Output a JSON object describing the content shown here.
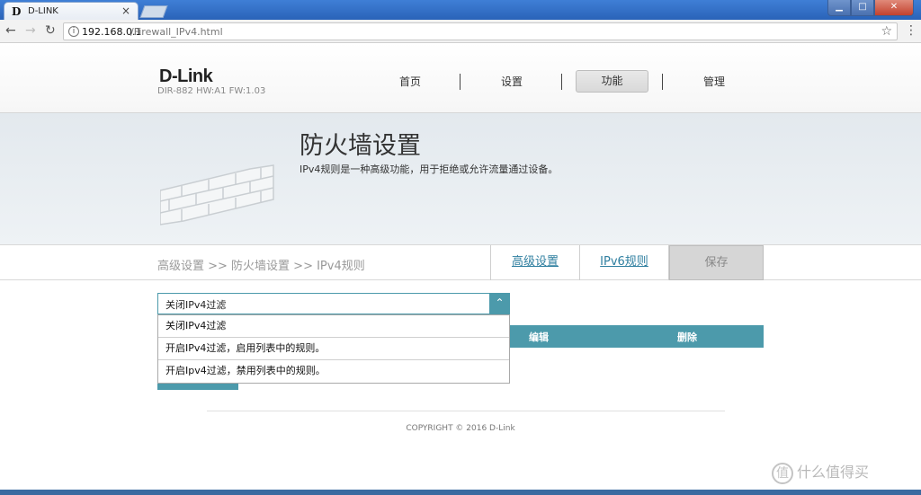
{
  "browser": {
    "tab_title": "D-LINK",
    "tab_favicon": "D",
    "tab_close": "×",
    "url_host": "192.168.0.1",
    "url_path": "/Firewall_IPv4.html",
    "win_min": "▁",
    "win_max": "□",
    "win_close": "✕"
  },
  "icons": {
    "back": "←",
    "forward": "→",
    "reload": "↻",
    "info": "i",
    "star": "☆",
    "menu": "⋮",
    "up_arrow": "⌃"
  },
  "header": {
    "logo": "D-Link",
    "model": "DIR-882 HW:A1 FW:1.03",
    "nav": [
      "首页",
      "设置",
      "功能",
      "管理"
    ]
  },
  "banner": {
    "title": "防火墙设置",
    "description": "IPv4规则是一种高级功能，用于拒绝或允许流量通过设备。"
  },
  "breadcrumb": "高级设置 >> 防火墙设置 >> IPv4规则",
  "tabs": {
    "advanced": "高级设置",
    "ipv6": "IPv6规则",
    "save": "保存"
  },
  "filter_select": {
    "value": "关闭IPv4过滤",
    "options": [
      "关闭IPv4过滤",
      "开启IPv4过滤，启用列表中的规则。",
      "开启Ipv4过滤，禁用列表中的规则。"
    ]
  },
  "table": {
    "headers": [
      "编辑",
      "删除"
    ]
  },
  "footer": {
    "copyright": "COPYRIGHT © 2016 D-Link"
  },
  "watermark": {
    "icon": "值",
    "text": "什么值得买"
  },
  "colors": {
    "accent": "#4c9aab",
    "link": "#2f7fa0"
  }
}
